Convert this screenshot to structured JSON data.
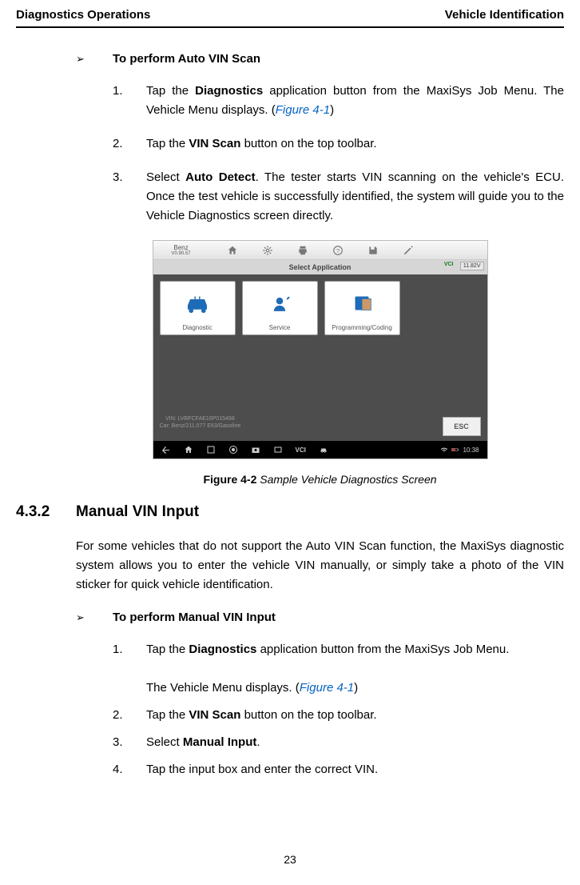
{
  "header": {
    "left": "Diagnostics Operations",
    "right": "Vehicle Identification"
  },
  "section1": {
    "bullet_title": "To perform Auto VIN Scan",
    "steps": [
      {
        "num": "1.",
        "pre": "Tap the ",
        "bold1": "Diagnostics",
        "mid": " application button from the MaxiSys Job Menu. The Vehicle Menu displays. (",
        "link": "Figure 4-1",
        "post": ")"
      },
      {
        "num": "2.",
        "pre": "Tap the ",
        "bold1": "VIN Scan",
        "mid": " button on the top toolbar.",
        "link": "",
        "post": ""
      },
      {
        "num": "3.",
        "pre": "Select ",
        "bold1": "Auto Detect",
        "mid": ". The tester starts VIN scanning on the vehicle's ECU. Once the test vehicle is successfully identified, the system will guide you to the Vehicle Diagnostics screen directly.",
        "link": "",
        "post": ""
      }
    ]
  },
  "figure": {
    "brand_line1": "Benz",
    "brand_line2": "V0.90.57",
    "subbar": "Select Application",
    "vci": "VCI",
    "voltage": "11.82V",
    "tiles": [
      {
        "label": "Diagnostic"
      },
      {
        "label": "Service"
      },
      {
        "label": "Programming/Coding"
      }
    ],
    "vin_line1": "VIN: LVBFCFAE16P015498",
    "vin_line2": "Car: Benz/211.077 E63/Gasoline",
    "esc": "ESC",
    "time": "10:38",
    "caption_bold": "Figure 4-2",
    "caption_ital": " Sample Vehicle Diagnostics Screen"
  },
  "section2": {
    "num": "4.3.2",
    "title": "Manual VIN Input",
    "para": "For some vehicles that do not support the Auto VIN Scan function, the MaxiSys diagnostic system allows you to enter the vehicle VIN manually, or simply take a photo of the VIN sticker for quick vehicle identification.",
    "bullet_title": "To perform Manual VIN Input",
    "steps": [
      {
        "num": "1.",
        "pre": "Tap the ",
        "bold1": "Diagnostics",
        "mid": " application button from the MaxiSys Job Menu.",
        "line2_pre": "The Vehicle Menu displays. (",
        "link": "Figure 4-1",
        "post": ")"
      },
      {
        "num": "2.",
        "pre": "Tap the ",
        "bold1": "VIN Scan",
        "mid": " button on the top toolbar.",
        "link": "",
        "post": ""
      },
      {
        "num": "3.",
        "pre": "Select ",
        "bold1": "Manual Input",
        "mid": ".",
        "link": "",
        "post": ""
      },
      {
        "num": "4.",
        "pre": "Tap the input box and enter the correct VIN.",
        "bold1": "",
        "mid": "",
        "link": "",
        "post": ""
      }
    ]
  },
  "page_number": "23"
}
